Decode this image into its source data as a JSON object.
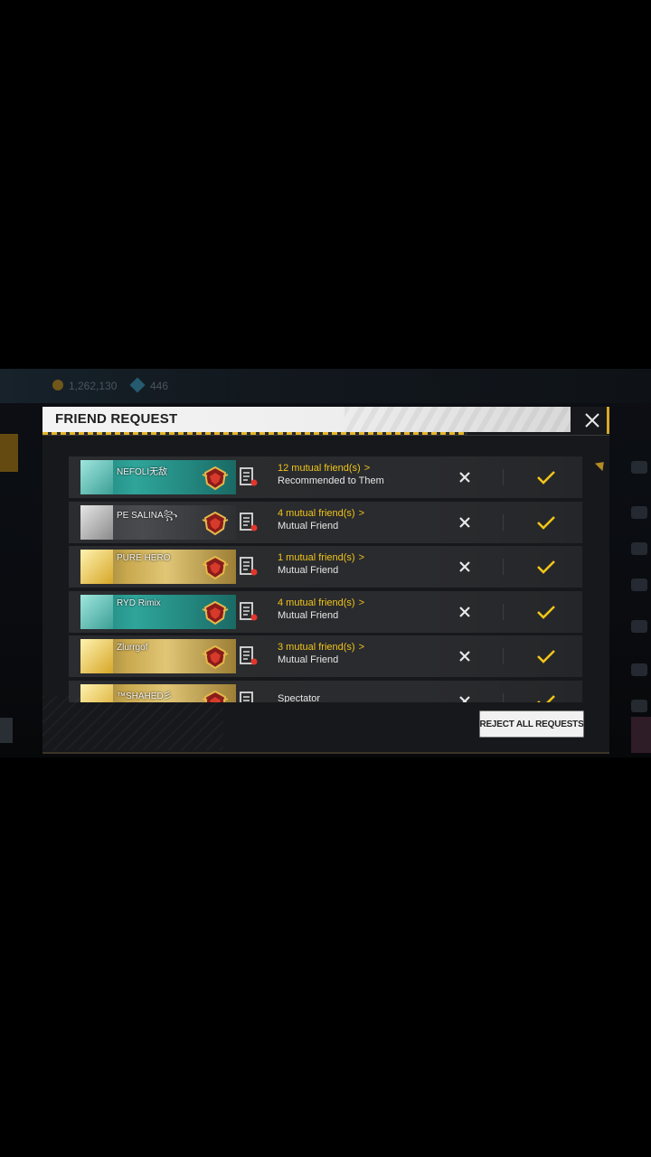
{
  "hud": {
    "coins": "1,262,130",
    "gems": "446"
  },
  "popup": {
    "title": "FRIEND REQUEST",
    "reject_all_label": "REJECT ALL REQUESTS",
    "requests": [
      {
        "name": "NEFOLI无敌",
        "mutual": "12 mutual friend(s)",
        "subtext": "Recommended to Them",
        "theme": "teal"
      },
      {
        "name": "PE   SALINA꧂",
        "mutual": "4 mutual friend(s)",
        "subtext": "Mutual Friend",
        "theme": "dark"
      },
      {
        "name": "PURE   HERO",
        "mutual": "1 mutual friend(s)",
        "subtext": "Mutual Friend",
        "theme": "gold"
      },
      {
        "name": "RYD   Rimix",
        "mutual": "4 mutual friend(s)",
        "subtext": "Mutual Friend",
        "theme": "teal"
      },
      {
        "name": "Zlurrgof",
        "mutual": "3 mutual friend(s)",
        "subtext": "Mutual Friend",
        "theme": "gold"
      },
      {
        "name": "™SHAHED彡",
        "mutual": "",
        "subtext": "Spectator",
        "theme": "gold"
      }
    ]
  },
  "icons": {
    "close": "close-icon",
    "reject": "reject-x-icon",
    "accept": "accept-check-icon",
    "note": "profile-note-icon",
    "rank": "rank-badge-icon"
  },
  "colors": {
    "accent_gold": "#f0c419",
    "popup_bg": "#17181b",
    "row_bg": "#2b2c2f",
    "header_bg": "#f4f4f4"
  }
}
